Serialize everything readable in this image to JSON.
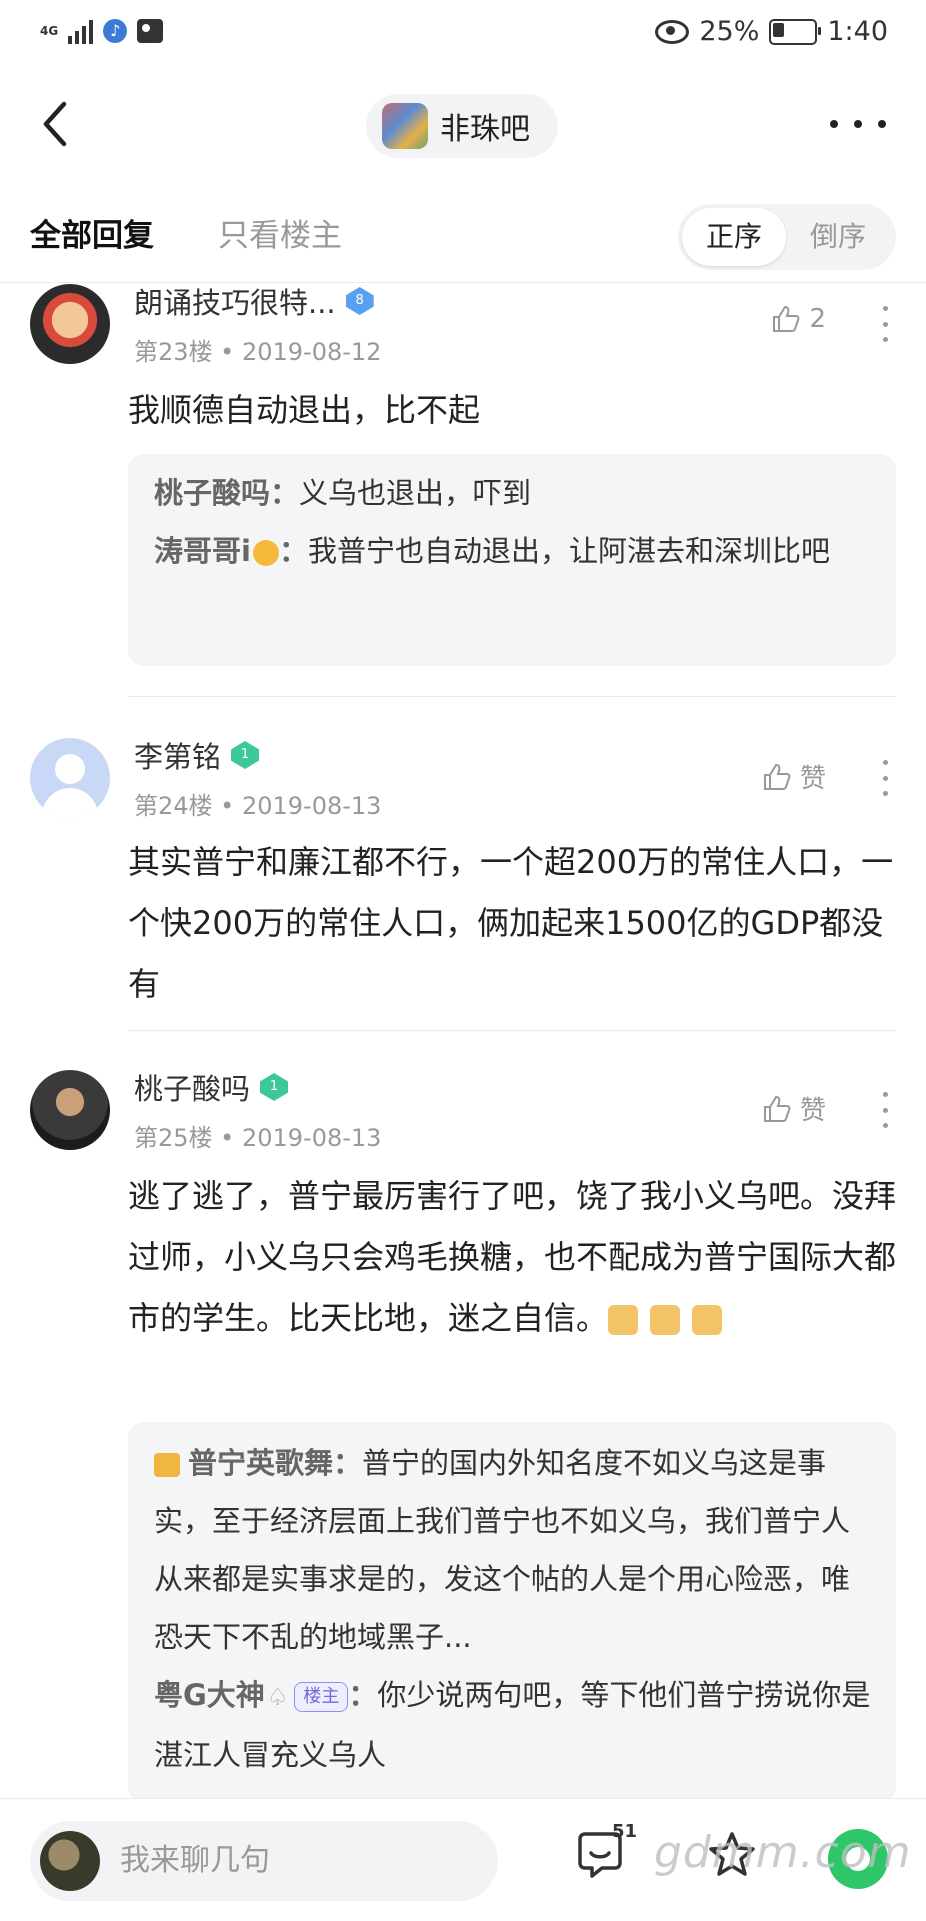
{
  "status_bar": {
    "network": "4G",
    "battery": "25%",
    "time": "1:40"
  },
  "nav": {
    "forum_name": "非珠吧"
  },
  "tabs": {
    "all_replies": "全部回复",
    "only_op": "只看楼主",
    "sort_asc": "正序",
    "sort_desc": "倒序"
  },
  "posts": [
    {
      "username": "朗诵技巧很特...",
      "level": "8",
      "floor_date": "第23楼 • 2019-08-12",
      "likes": "2",
      "content": "我顺德自动退出，比不起",
      "replies": [
        {
          "author": "桃子酸吗：",
          "text": "义乌也退出，吓到"
        },
        {
          "author": "涛哥哥i",
          "sep": "：",
          "text": "我普宁也自动退出，让阿湛去和深圳比吧"
        }
      ]
    },
    {
      "username": "李第铭",
      "level": "1",
      "floor_date": "第24楼 • 2019-08-13",
      "likes": "赞",
      "content": "其实普宁和廉江都不行，一个超200万的常住人口，一个快200万的常住人口，俩加起来1500亿的GDP都没有"
    },
    {
      "username": "桃子酸吗",
      "level": "1",
      "floor_date": "第25楼 • 2019-08-13",
      "likes": "赞",
      "content": "逃了逃了，普宁最厉害行了吧，饶了我小义乌吧。没拜过师，小义乌只会鸡毛换糖，也不配成为普宁国际大都市的学生。比天比地，迷之自信。",
      "replies": [
        {
          "author": "普宁英歌舞：",
          "text": "普宁的国内外知名度不如义乌这是事实，至于经济层面上我们普宁也不如义乌，我们普宁人从来都是实事求是的，发这个帖的人是个用心险恶，唯恐天下不乱的地域黑子..."
        },
        {
          "author": "粤G大神",
          "badge": "楼主",
          "sep": "：",
          "text": "你少说两句吧，等下他们普宁捞说你是湛江人冒充义乌人"
        }
      ]
    }
  ],
  "bottom_bar": {
    "input_placeholder": "我来聊几句",
    "comment_count": "51",
    "watermark": "gdmm.com"
  },
  "icons": {
    "back": "chevron-left-icon",
    "more": "more-horizontal-icon",
    "like": "thumb-up-icon",
    "kebab": "more-vertical-icon",
    "comment": "comment-icon",
    "star": "star-icon",
    "share": "share-icon"
  },
  "colors": {
    "level_blue": "#5aa0f0",
    "level_green": "#3cc89a",
    "share_green": "#2fc66a",
    "op_badge": "#6b6bde"
  }
}
